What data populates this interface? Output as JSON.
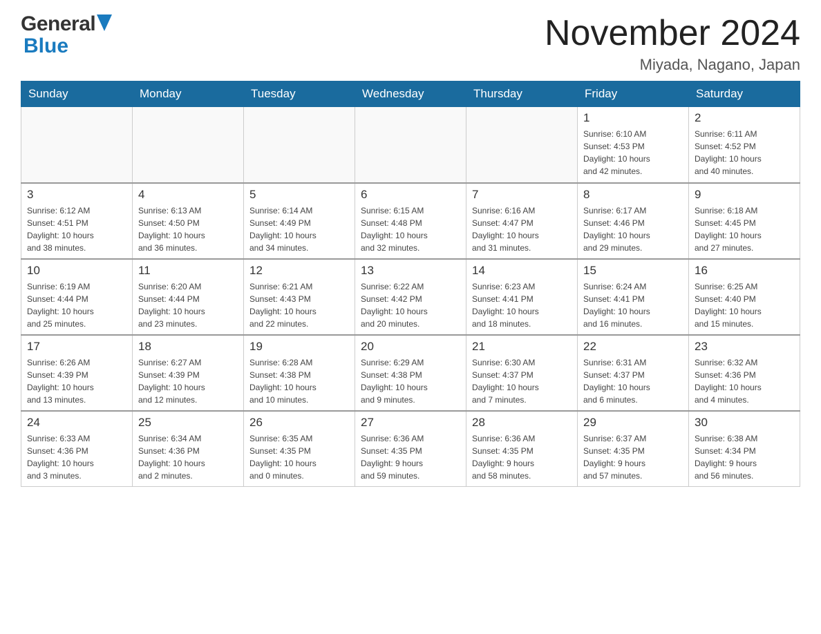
{
  "logo": {
    "text_general": "General",
    "text_blue": "Blue"
  },
  "header": {
    "month_year": "November 2024",
    "location": "Miyada, Nagano, Japan"
  },
  "weekdays": [
    "Sunday",
    "Monday",
    "Tuesday",
    "Wednesday",
    "Thursday",
    "Friday",
    "Saturday"
  ],
  "weeks": [
    [
      {
        "day": "",
        "info": ""
      },
      {
        "day": "",
        "info": ""
      },
      {
        "day": "",
        "info": ""
      },
      {
        "day": "",
        "info": ""
      },
      {
        "day": "",
        "info": ""
      },
      {
        "day": "1",
        "info": "Sunrise: 6:10 AM\nSunset: 4:53 PM\nDaylight: 10 hours\nand 42 minutes."
      },
      {
        "day": "2",
        "info": "Sunrise: 6:11 AM\nSunset: 4:52 PM\nDaylight: 10 hours\nand 40 minutes."
      }
    ],
    [
      {
        "day": "3",
        "info": "Sunrise: 6:12 AM\nSunset: 4:51 PM\nDaylight: 10 hours\nand 38 minutes."
      },
      {
        "day": "4",
        "info": "Sunrise: 6:13 AM\nSunset: 4:50 PM\nDaylight: 10 hours\nand 36 minutes."
      },
      {
        "day": "5",
        "info": "Sunrise: 6:14 AM\nSunset: 4:49 PM\nDaylight: 10 hours\nand 34 minutes."
      },
      {
        "day": "6",
        "info": "Sunrise: 6:15 AM\nSunset: 4:48 PM\nDaylight: 10 hours\nand 32 minutes."
      },
      {
        "day": "7",
        "info": "Sunrise: 6:16 AM\nSunset: 4:47 PM\nDaylight: 10 hours\nand 31 minutes."
      },
      {
        "day": "8",
        "info": "Sunrise: 6:17 AM\nSunset: 4:46 PM\nDaylight: 10 hours\nand 29 minutes."
      },
      {
        "day": "9",
        "info": "Sunrise: 6:18 AM\nSunset: 4:45 PM\nDaylight: 10 hours\nand 27 minutes."
      }
    ],
    [
      {
        "day": "10",
        "info": "Sunrise: 6:19 AM\nSunset: 4:44 PM\nDaylight: 10 hours\nand 25 minutes."
      },
      {
        "day": "11",
        "info": "Sunrise: 6:20 AM\nSunset: 4:44 PM\nDaylight: 10 hours\nand 23 minutes."
      },
      {
        "day": "12",
        "info": "Sunrise: 6:21 AM\nSunset: 4:43 PM\nDaylight: 10 hours\nand 22 minutes."
      },
      {
        "day": "13",
        "info": "Sunrise: 6:22 AM\nSunset: 4:42 PM\nDaylight: 10 hours\nand 20 minutes."
      },
      {
        "day": "14",
        "info": "Sunrise: 6:23 AM\nSunset: 4:41 PM\nDaylight: 10 hours\nand 18 minutes."
      },
      {
        "day": "15",
        "info": "Sunrise: 6:24 AM\nSunset: 4:41 PM\nDaylight: 10 hours\nand 16 minutes."
      },
      {
        "day": "16",
        "info": "Sunrise: 6:25 AM\nSunset: 4:40 PM\nDaylight: 10 hours\nand 15 minutes."
      }
    ],
    [
      {
        "day": "17",
        "info": "Sunrise: 6:26 AM\nSunset: 4:39 PM\nDaylight: 10 hours\nand 13 minutes."
      },
      {
        "day": "18",
        "info": "Sunrise: 6:27 AM\nSunset: 4:39 PM\nDaylight: 10 hours\nand 12 minutes."
      },
      {
        "day": "19",
        "info": "Sunrise: 6:28 AM\nSunset: 4:38 PM\nDaylight: 10 hours\nand 10 minutes."
      },
      {
        "day": "20",
        "info": "Sunrise: 6:29 AM\nSunset: 4:38 PM\nDaylight: 10 hours\nand 9 minutes."
      },
      {
        "day": "21",
        "info": "Sunrise: 6:30 AM\nSunset: 4:37 PM\nDaylight: 10 hours\nand 7 minutes."
      },
      {
        "day": "22",
        "info": "Sunrise: 6:31 AM\nSunset: 4:37 PM\nDaylight: 10 hours\nand 6 minutes."
      },
      {
        "day": "23",
        "info": "Sunrise: 6:32 AM\nSunset: 4:36 PM\nDaylight: 10 hours\nand 4 minutes."
      }
    ],
    [
      {
        "day": "24",
        "info": "Sunrise: 6:33 AM\nSunset: 4:36 PM\nDaylight: 10 hours\nand 3 minutes."
      },
      {
        "day": "25",
        "info": "Sunrise: 6:34 AM\nSunset: 4:36 PM\nDaylight: 10 hours\nand 2 minutes."
      },
      {
        "day": "26",
        "info": "Sunrise: 6:35 AM\nSunset: 4:35 PM\nDaylight: 10 hours\nand 0 minutes."
      },
      {
        "day": "27",
        "info": "Sunrise: 6:36 AM\nSunset: 4:35 PM\nDaylight: 9 hours\nand 59 minutes."
      },
      {
        "day": "28",
        "info": "Sunrise: 6:36 AM\nSunset: 4:35 PM\nDaylight: 9 hours\nand 58 minutes."
      },
      {
        "day": "29",
        "info": "Sunrise: 6:37 AM\nSunset: 4:35 PM\nDaylight: 9 hours\nand 57 minutes."
      },
      {
        "day": "30",
        "info": "Sunrise: 6:38 AM\nSunset: 4:34 PM\nDaylight: 9 hours\nand 56 minutes."
      }
    ]
  ]
}
